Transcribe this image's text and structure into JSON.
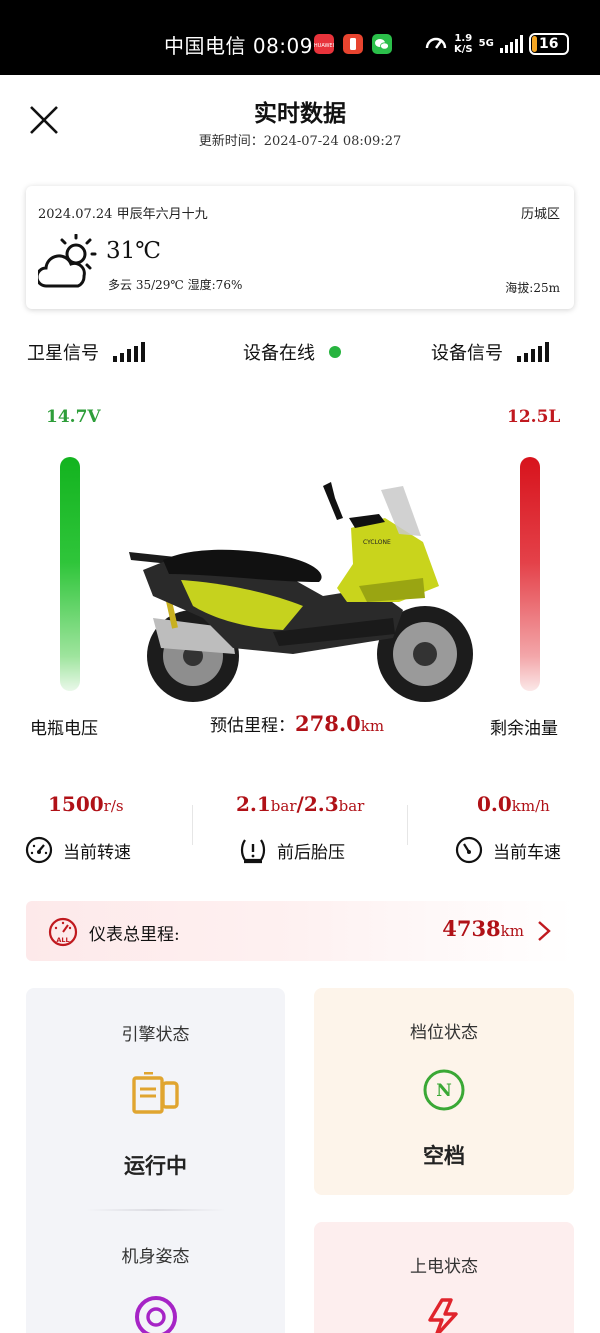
{
  "status_bar": {
    "carrier_time": "中国电信 08:09",
    "net_speed_value": "1.9",
    "net_speed_unit": "K/S",
    "network": "5G",
    "battery": "16",
    "battery_fraction": 0.16
  },
  "header": {
    "title": "实时数据",
    "update_label": "更新时间：",
    "update_time": "2024-07-24 08:09:27"
  },
  "weather": {
    "date_lunar": "2024.07.24 甲辰年六月十九",
    "district": "历城区",
    "temperature": "31℃",
    "desc": "多云 35/29℃ 湿度:76%",
    "altitude": "海拔:25m",
    "icon": "partly-cloudy-icon"
  },
  "signals": {
    "satellite_label": "卫星信号",
    "online_label": "设备在线",
    "device_label": "设备信号",
    "online_color": "#27b43f"
  },
  "gauges": {
    "voltage_value": "14.7V",
    "voltage_label": "电瓶电压",
    "oil_value": "12.5L",
    "oil_label": "剩余油量",
    "voltage_color": "#2e9e3a",
    "oil_color": "#c0191f"
  },
  "range": {
    "label": "预估里程：",
    "value": "278.0",
    "unit": "km"
  },
  "metrics": {
    "rpm_value": "1500",
    "rpm_unit": "r/s",
    "rpm_label": "当前转速",
    "tire_front": "2.1",
    "tire_rear": "2.3",
    "tire_unit": "bar",
    "tire_sep": "/",
    "tire_label": "前后胎压",
    "speed_value": "0.0",
    "speed_unit": "km/h",
    "speed_label": "当前车速"
  },
  "odometer": {
    "label": "仪表总里程:",
    "value": "4738",
    "unit": "km",
    "icon_text": "ALL"
  },
  "cards": {
    "engine_title": "引擎状态",
    "engine_value": "运行中",
    "posture_title": "机身姿态",
    "gear_title": "档位状态",
    "gear_letter": "N",
    "gear_value": "空档",
    "power_title": "上电状态"
  }
}
